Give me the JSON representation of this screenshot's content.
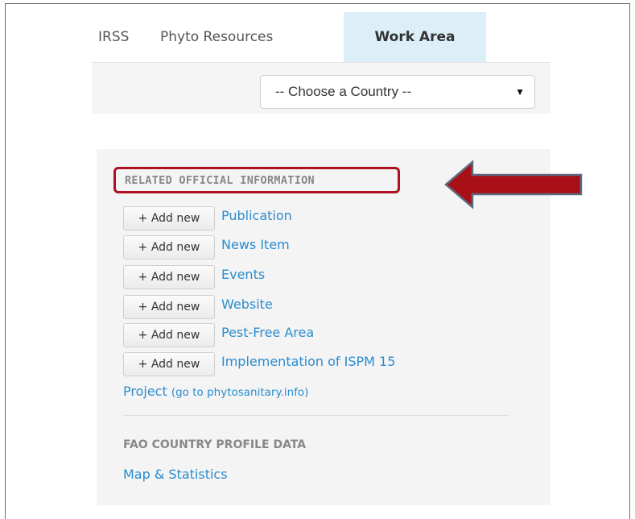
{
  "nav": {
    "tabs": [
      {
        "label": "IRSS",
        "active": false
      },
      {
        "label": "Phyto Resources",
        "active": false
      },
      {
        "label": "Work Area",
        "active": true
      }
    ]
  },
  "country_select": {
    "value": "-- Choose a Country --",
    "arrow": "▼"
  },
  "related": {
    "heading": "RELATED OFFICIAL INFORMATION",
    "highlight_color": "#b0101f",
    "items": [
      {
        "button": "+ Add new",
        "link": "Publication"
      },
      {
        "button": "+ Add new",
        "link": "News Item"
      },
      {
        "button": "+ Add new",
        "link": "Events"
      },
      {
        "button": "+ Add new",
        "link": "Website"
      },
      {
        "button": "+ Add new",
        "link": "Pest-Free Area"
      },
      {
        "button": "+ Add new",
        "link": "Implementation of ISPM 15"
      }
    ],
    "project_label": "Project",
    "project_sub": "(go to phytosanitary.info)"
  },
  "fao": {
    "heading": "FAO COUNTRY PROFILE DATA",
    "link": "Map & Statistics"
  },
  "colors": {
    "link": "#2a8ccf",
    "active_tab_bg": "#dceef8",
    "arrow": "#a80f17"
  }
}
